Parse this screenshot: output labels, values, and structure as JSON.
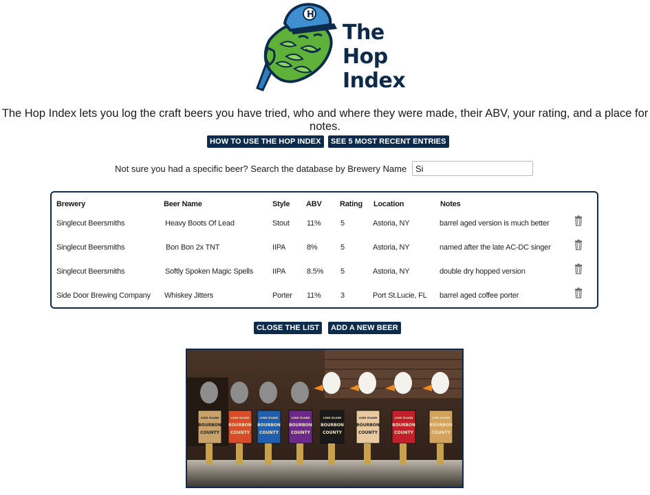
{
  "logo": {
    "title_lines": [
      "The",
      "Hop",
      "Index"
    ],
    "icon": "hop-mascot-logo"
  },
  "intro_text": "The Hop Index lets you log the craft beers you have tried, who and where they were made, their ABV, your rating, and a place for notes.",
  "buttons": {
    "how_to": "HOW TO USE THE HOP INDEX",
    "recent": "SEE 5 MOST RECENT ENTRIES",
    "close_list": "CLOSE THE LIST",
    "add_beer": "ADD A NEW BEER"
  },
  "search": {
    "label": "Not sure you had a specific beer? Search the database by Brewery Name",
    "value": "Si"
  },
  "table": {
    "headers": {
      "brewery": "Brewery",
      "beer": "Beer Name",
      "style": "Style",
      "abv": "ABV",
      "rating": "Rating",
      "location": "Location",
      "notes": "Notes"
    },
    "rows": [
      {
        "brewery": "Singlecut Beersmiths",
        "beer": "Heavy Boots Of Lead",
        "style": "Stout",
        "abv": "11%",
        "rating": "5",
        "location": "Astoria, NY",
        "notes": "barrel aged version is much better"
      },
      {
        "brewery": "Singlecut Beersmiths",
        "beer": "Bon Bon 2x TNT",
        "style": "IIPA",
        "abv": "8%",
        "rating": "5",
        "location": "Astoria, NY",
        "notes": "named after the late AC-DC singer"
      },
      {
        "brewery": "Singlecut Beersmiths",
        "beer": "Softly Spoken Magic Spells",
        "style": "IIPA",
        "abv": "8.5%",
        "rating": "5",
        "location": "Astoria, NY",
        "notes": "double dry hopped version"
      },
      {
        "brewery": "Side Door Brewing Company",
        "beer": "Whiskey Jitters",
        "style": "Porter",
        "abv": "11%",
        "rating": "3",
        "location": "Port St.Lucie, FL",
        "notes": "barrel aged coffee porter"
      }
    ],
    "delete_icon": "trash-icon"
  },
  "photo": {
    "subject": "beer-tap-handles-photo",
    "tap_label_lines": [
      "LONG ISLAND",
      "BOURBON",
      "COUNTY"
    ]
  },
  "colors": {
    "navy": "#0d2c4d",
    "hop_green": "#5fb13a",
    "cap_blue": "#3f8fd0"
  }
}
